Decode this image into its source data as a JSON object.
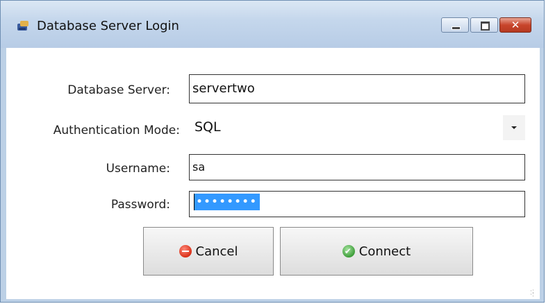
{
  "window": {
    "title": "Database Server Login"
  },
  "form": {
    "server": {
      "label": "Database Server:",
      "value": "servertwo"
    },
    "auth": {
      "label": "Authentication Mode:",
      "value": "SQL"
    },
    "username": {
      "label": "Username:",
      "value": "sa"
    },
    "password": {
      "label": "Password:",
      "value": "••••••••"
    }
  },
  "buttons": {
    "cancel": "Cancel",
    "connect": "Connect"
  },
  "colors": {
    "selection": "#3399ff",
    "title_bar": "#c5d7ec",
    "close_button": "#c8452c"
  },
  "icons": {
    "app": "database-login-icon",
    "cancel": "cancel-circle-icon",
    "connect": "check-circle-icon"
  }
}
